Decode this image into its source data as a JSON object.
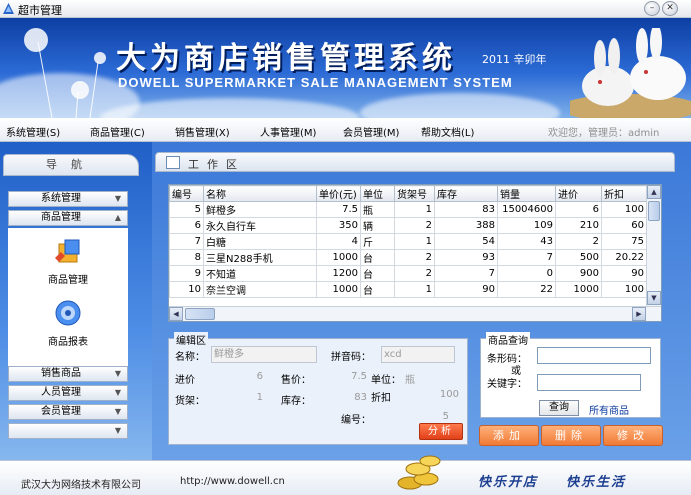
{
  "window": {
    "title": "超市管理",
    "min_label": "–",
    "max_label": "□",
    "close_label": "✕"
  },
  "banner": {
    "title_cn": "大为商店销售管理系统",
    "title_en": "DOWELL SUPERMARKET SALE MANAGEMENT SYSTEM",
    "year": "2011 辛卯年"
  },
  "menu": {
    "items": [
      {
        "label": "系统管理(S)"
      },
      {
        "label": "商品管理(C)"
      },
      {
        "label": "销售管理(X)"
      },
      {
        "label": "人事管理(M)"
      },
      {
        "label": "会员管理(M)"
      },
      {
        "label": "帮助文档(L)"
      }
    ],
    "welcome": "欢迎您，管理员：admin"
  },
  "nav": {
    "header": "导航",
    "sections": [
      {
        "label": "系统管理"
      },
      {
        "label": "商品管理"
      },
      {
        "label": "销售商品"
      },
      {
        "label": "人员管理"
      },
      {
        "label": "会员管理"
      }
    ],
    "tiles": [
      {
        "label": "商品管理",
        "icon": "box-edit-icon"
      },
      {
        "label": "商品报表",
        "icon": "report-icon"
      }
    ]
  },
  "work": {
    "header": "工作区",
    "columns": [
      "编号",
      "名称",
      "单价(元)",
      "单位",
      "货架号",
      "库存",
      "销量",
      "进价",
      "折扣"
    ],
    "rows": [
      [
        "5",
        "鲜橙多",
        "7.5",
        "瓶",
        "1",
        "83",
        "15004600",
        "6",
        "100"
      ],
      [
        "6",
        "永久自行车",
        "350",
        "辆",
        "2",
        "388",
        "109",
        "210",
        "60"
      ],
      [
        "7",
        "白糖",
        "4",
        "斤",
        "1",
        "54",
        "43",
        "2",
        "75"
      ],
      [
        "8",
        "三星N288手机",
        "1000",
        "台",
        "2",
        "93",
        "7",
        "500",
        "20.22"
      ],
      [
        "9",
        "不知道",
        "1200",
        "台",
        "2",
        "7",
        "0",
        "900",
        "90"
      ],
      [
        "10",
        "奈兰空调",
        "1000",
        "台",
        "1",
        "90",
        "22",
        "1000",
        "100"
      ]
    ]
  },
  "edit": {
    "legend": "编辑区",
    "name_label": "名称：",
    "name_value": "鲜橙多",
    "pinyin_label": "拼音码：",
    "pinyin_value": "xcd",
    "cost_label": "进价",
    "cost_value": "6",
    "price_label": "售价：",
    "price_value": "7.5",
    "unit_label": "单位：",
    "unit_value": "瓶",
    "shelf_label": "货架：",
    "shelf_value": "1",
    "stock_label": "库存：",
    "stock_value": "83",
    "discount_label": "折扣",
    "discount_value": "100",
    "id_label": "编号：",
    "id_value": "5",
    "analyze_button": "分析"
  },
  "query": {
    "legend": "商品查询",
    "barcode_label": "条形码：",
    "or_label": "或",
    "keyword_label": "关键字：",
    "search_button": "查询",
    "all_link": "所有商品"
  },
  "actions": {
    "add": "添加",
    "delete": "删除",
    "modify": "修改"
  },
  "footer": {
    "company": "武汉大为网络技术有限公司",
    "url": "http://www.dowell.cn",
    "slogan_1": "快乐开店",
    "slogan_2": "快乐生活"
  }
}
